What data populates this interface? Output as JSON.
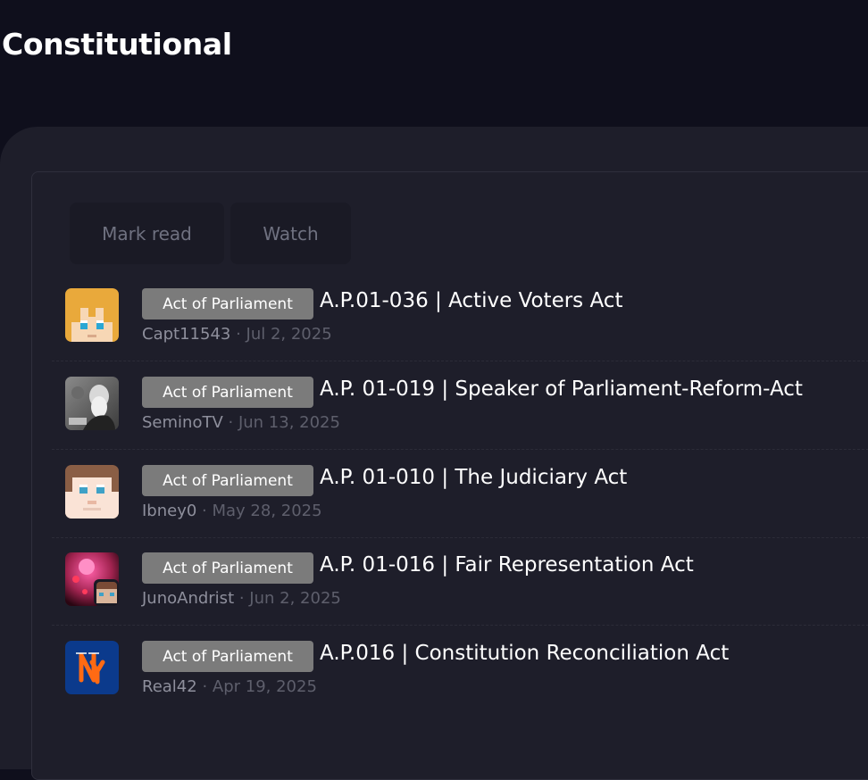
{
  "page": {
    "title": "Constitutional"
  },
  "actions": {
    "mark_read": "Mark read",
    "watch": "Watch"
  },
  "threads": [
    {
      "prefix": "Act of Parliament",
      "title": "A.P.01-036 | Active Voters Act",
      "author": "Capt11543",
      "date": "Jul 2, 2025",
      "avatar": "orange-haired-character-avatar"
    },
    {
      "prefix": "Act of Parliament",
      "title": "A.P. 01-019 | Speaker of Parliament-Reform-Act",
      "author": "SeminoTV",
      "date": "Jun 13, 2025",
      "avatar": "vintage-portrait-avatar"
    },
    {
      "prefix": "Act of Parliament",
      "title": "A.P. 01-010 | The Judiciary Act",
      "author": "Ibney0",
      "date": "May 28, 2025",
      "avatar": "brown-haired-character-avatar"
    },
    {
      "prefix": "Act of Parliament",
      "title": "A.P. 01-016 | Fair Representation Act",
      "author": "JunoAndrist",
      "date": "Jun 2, 2025",
      "avatar": "pink-concert-avatar"
    },
    {
      "prefix": "Act of Parliament",
      "title": "A.P.016 | Constitution Reconciliation Act",
      "author": "Real42",
      "date": "Apr 19, 2025",
      "avatar": "ny-logo-avatar"
    }
  ],
  "colors": {
    "background": "#0f0f1c",
    "panel": "#1e1e2a",
    "prefix_bg": "#7b7b7b",
    "muted": "#5e5f6c"
  }
}
